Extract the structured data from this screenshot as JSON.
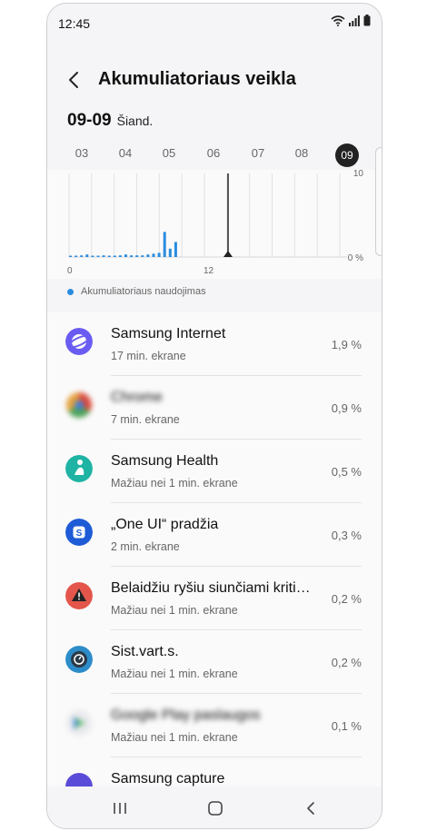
{
  "status": {
    "time": "12:45"
  },
  "header": {
    "title": "Akumuliatoriaus veikla"
  },
  "date": {
    "value": "09-09",
    "label": "Šiand."
  },
  "hours": [
    "03",
    "04",
    "05",
    "06",
    "07",
    "08",
    "09"
  ],
  "chart_data": {
    "type": "bar",
    "ylabel_top": "10",
    "ylabel_bottom": "0 %",
    "xlabels": [
      "0",
      "12"
    ],
    "ylim": [
      0,
      10
    ],
    "values": [
      0.1,
      0.1,
      0.2,
      0.3,
      0.1,
      0.1,
      0.2,
      0.1,
      0.1,
      0.2,
      0.3,
      0.2,
      0.2,
      0.2,
      0.3,
      0.4,
      0.5,
      3.0,
      1.0,
      1.8
    ],
    "current_marker": 24,
    "legend": "Akumuliatoriaus naudojimas",
    "color": "#2a8cdf"
  },
  "apps": [
    {
      "name": "Samsung Internet",
      "sub": "17 min. ekrane",
      "pct": "1,9 %",
      "icon": "samsung-internet-icon",
      "color": "#6a5cf2"
    },
    {
      "name": "Chrome",
      "sub": "7 min. ekrane",
      "pct": "0,9 %",
      "icon": "chrome-icon",
      "color": "#e5a13b",
      "blurred": true
    },
    {
      "name": "Samsung Health",
      "sub": "Mažiau nei 1 min. ekrane",
      "pct": "0,5 %",
      "icon": "samsung-health-icon",
      "color": "#1fb3a4"
    },
    {
      "name": "„One UI“ pradžia",
      "sub": "2 min. ekrane",
      "pct": "0,3 %",
      "icon": "one-ui-home-icon",
      "color": "#1e5bd6"
    },
    {
      "name": "Belaidžiu ryšiu siunčiami kriti…",
      "sub": "Mažiau nei 1 min. ekrane",
      "pct": "0,2 %",
      "icon": "warning-icon",
      "color": "#e4564b"
    },
    {
      "name": "Sist.vart.s.",
      "sub": "Mažiau nei 1 min. ekrane",
      "pct": "0,2 %",
      "icon": "system-ui-icon",
      "color": "#2c8cc9"
    },
    {
      "name": "Google Play paslaugos",
      "sub": "Mažiau nei 1 min. ekrane",
      "pct": "0,1 %",
      "icon": "google-play-services-icon",
      "color": "#6bbf6a",
      "blurred": true
    },
    {
      "name": "Samsung capture",
      "sub": "",
      "pct": "",
      "icon": "samsung-capture-icon",
      "color": "#5a4cd8"
    }
  ]
}
